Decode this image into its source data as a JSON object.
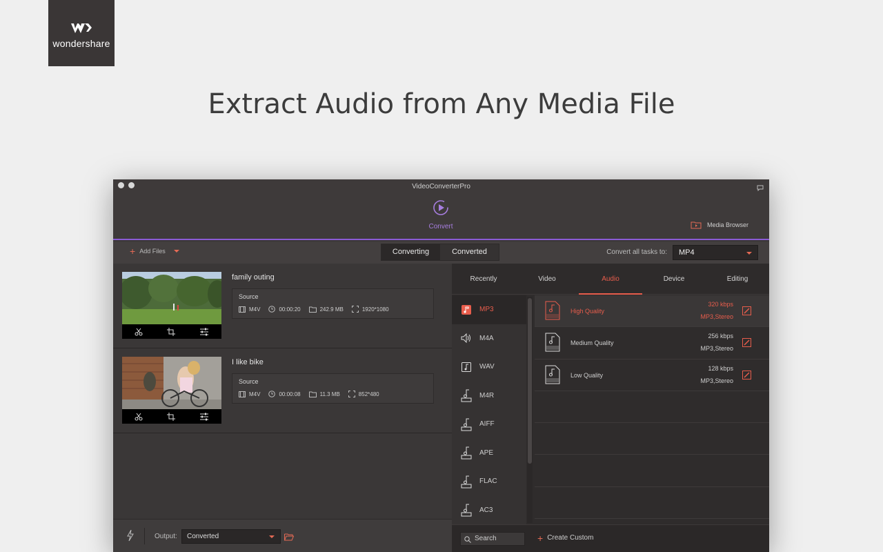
{
  "logo": {
    "text": "wondershare"
  },
  "headline": "Extract Audio from Any Media File",
  "app": {
    "title": "VideoConverterPro",
    "convert_label": "Convert",
    "media_browser": "Media Browser"
  },
  "toolbar": {
    "add_files": "Add Files",
    "tab_converting": "Converting",
    "tab_converted": "Converted",
    "convert_all_label": "Convert all tasks to:",
    "convert_all_value": "MP4"
  },
  "files": [
    {
      "name": "family outing",
      "source_label": "Source",
      "format": "M4V",
      "duration": "00:00:20",
      "size": "242.9 MB",
      "resolution": "1920*1080"
    },
    {
      "name": "I like bike",
      "source_label": "Source",
      "format": "M4V",
      "duration": "00:00:08",
      "size": "11.3 MB",
      "resolution": "852*480"
    }
  ],
  "bottom": {
    "output_label": "Output:",
    "output_value": "Converted"
  },
  "panel": {
    "tabs": [
      "Recently",
      "Video",
      "Audio",
      "Device",
      "Editing"
    ],
    "active_tab": "Audio",
    "formats": [
      "MP3",
      "M4A",
      "WAV",
      "M4R",
      "AIFF",
      "APE",
      "FLAC",
      "AC3"
    ],
    "active_format": "MP3",
    "qualities": [
      {
        "name": "High Quality",
        "kbps": "320 kbps",
        "fmt": "MP3,Stereo",
        "badge": "HIGH"
      },
      {
        "name": "Medium Quality",
        "kbps": "256 kbps",
        "fmt": "MP3,Stereo",
        "badge": "MEDIUM"
      },
      {
        "name": "Low Quality",
        "kbps": "128 kbps",
        "fmt": "MP3,Stereo",
        "badge": "LOW"
      }
    ],
    "search_placeholder": "Search",
    "create_custom": "Create Custom"
  },
  "colors": {
    "accent": "#e85d4c",
    "convert_purple": "#a77ee0"
  }
}
